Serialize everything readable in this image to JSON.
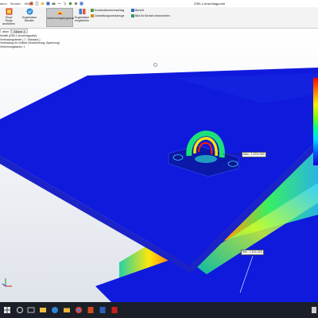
{
  "window": {
    "title": "ZSB-1-Anschlagpunkt"
  },
  "menu": {
    "items": [
      "ation",
      "Senden",
      "Hilfe"
    ]
  },
  "ribbon": {
    "buttons": [
      {
        "label": "Show Study",
        "sub": "ausführen"
      },
      {
        "label": "Ergebnisse",
        "sub": "Berater"
      },
      {
        "label": "Verformungsergebnis",
        "sub": ""
      },
      {
        "label": "Ergebnisse",
        "sub": "vergleichen"
      }
    ],
    "rows": [
      {
        "label": "Konstruktionsvorschlag"
      },
      {
        "label": "Darstellungswerkzeuge"
      },
      {
        "label": "Bericht"
      },
      {
        "label": "Bild für Bericht einbeziehen"
      }
    ]
  },
  "tabs": [
    "ation",
    "Skizze 3"
  ],
  "tree": {
    "items": [
      "Modell (ZSB-1-Anschlagpunkt)",
      "Verbindungsfehler (-7- Standard-)",
      "Verbindung für Vollbild (Verschiebung, Spannung)",
      "Verformungsfaktor: 1"
    ]
  },
  "callouts": [
    {
      "text": "Max.: 1.67e+002"
    },
    {
      "text": "Min.: 1.67e-004"
    }
  ],
  "colors": {
    "model_blue": "#0f1adc",
    "stress_red": "#ff2000",
    "stress_yellow": "#ffe600",
    "stress_green": "#36d81e",
    "taskbar": "#1b1f27"
  },
  "taskbar": {
    "icons": [
      "windows-icon",
      "search-icon",
      "taskview-icon",
      "file-explorer-icon",
      "edge-icon",
      "folder-icon",
      "browser-icon",
      "office-icon",
      "word-icon",
      "acrobat-icon"
    ]
  }
}
